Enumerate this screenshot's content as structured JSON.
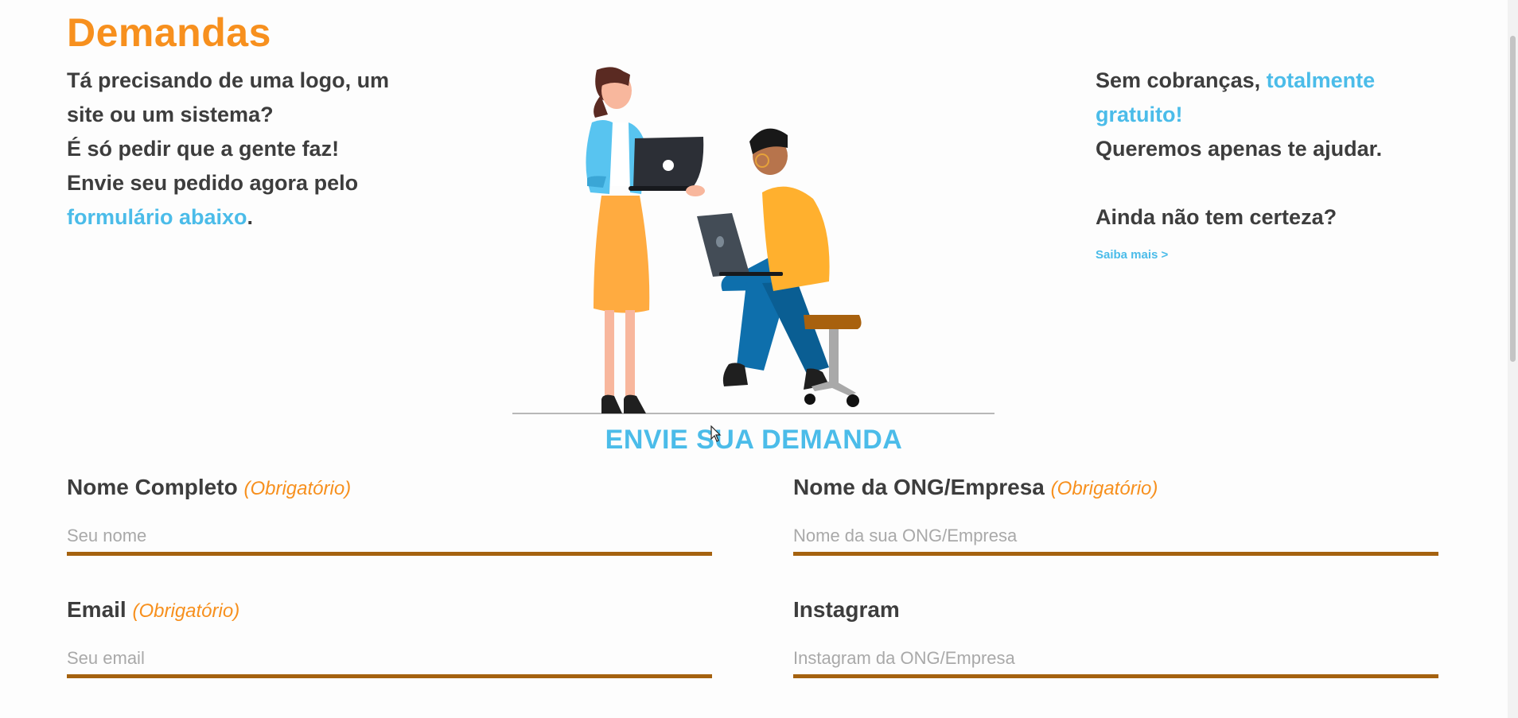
{
  "page": {
    "title": "Demandas"
  },
  "intro_left": {
    "line1": "Tá precisando de uma logo, um site ou um sistema?",
    "line2": "É só pedir que a gente faz!",
    "line3": "Envie seu pedido agora pelo",
    "link": "formulário abaixo",
    "period": "."
  },
  "intro_right": {
    "text1": "Sem cobranças,",
    "highlight": "totalmente gratuito!",
    "text2": "Queremos apenas te ajudar.",
    "question": "Ainda não tem certeza?",
    "saiba_mais": "Saiba mais >"
  },
  "form": {
    "title": "ENVIE SUA DEMANDA",
    "fields": [
      {
        "label": "Nome Completo",
        "required": "(Obrigatório)",
        "placeholder": "Seu nome"
      },
      {
        "label": "Nome da ONG/Empresa",
        "required": "(Obrigatório)",
        "placeholder": "Nome da sua ONG/Empresa"
      },
      {
        "label": "Email",
        "required": "(Obrigatório)",
        "placeholder": "Seu email"
      },
      {
        "label": "Instagram",
        "required": "",
        "placeholder": "Instagram da ONG/Empresa"
      }
    ]
  },
  "colors": {
    "accent_orange": "#f7901e",
    "accent_blue": "#4bbce9",
    "input_underline": "#a5620f",
    "text_dark": "#3d3d3d"
  }
}
